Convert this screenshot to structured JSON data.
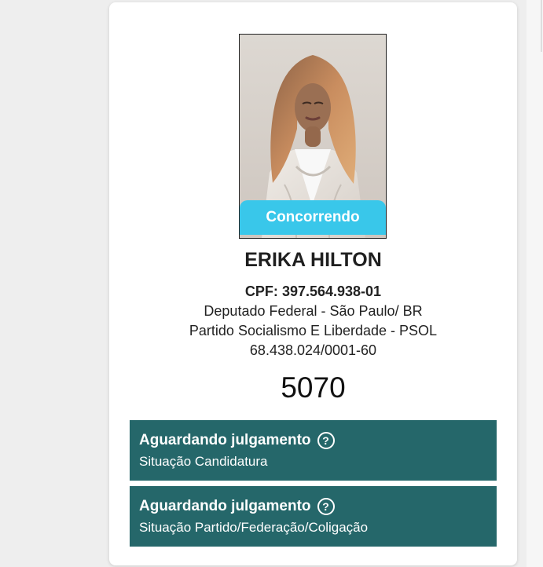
{
  "candidate": {
    "badge": "Concorrendo",
    "name": "ERIKA HILTON",
    "cpf_label": "CPF:",
    "cpf_value": "397.564.938-01",
    "role": "Deputado Federal - São Paulo/ BR",
    "party": "Partido Socialismo E Liberdade - PSOL",
    "cnpj": "68.438.024/0001-60",
    "number": "5070"
  },
  "statuses": [
    {
      "title": "Aguardando julgamento",
      "subtitle": "Situação Candidatura",
      "icon": "help-icon"
    },
    {
      "title": "Aguardando julgamento",
      "subtitle": "Situação Partido/Federação/Coligação",
      "icon": "help-icon"
    }
  ],
  "colors": {
    "badge": "#39c7ea",
    "status_box": "#25676a",
    "page_bg": "#eeeeee",
    "card_bg": "#ffffff"
  }
}
